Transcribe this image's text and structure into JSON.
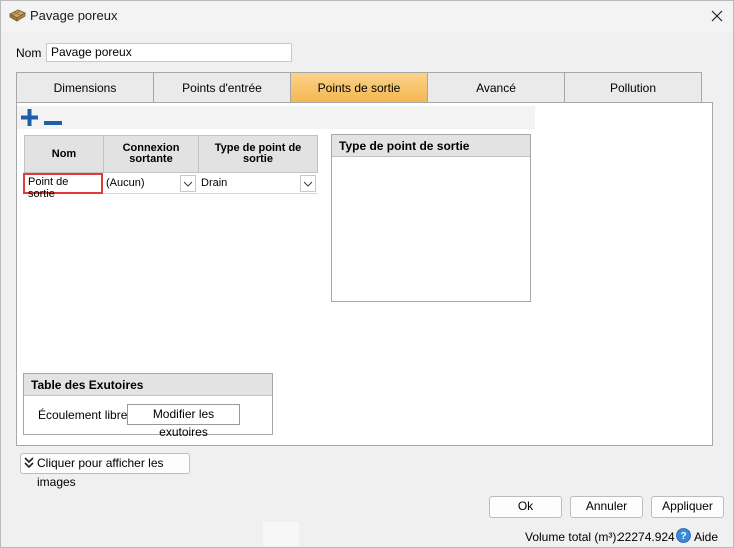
{
  "window": {
    "title": "Pavage poreux"
  },
  "name_field": {
    "label": "Nom",
    "value": "Pavage poreux"
  },
  "tabs": [
    {
      "label": "Dimensions",
      "active": false
    },
    {
      "label": "Points d'entrée",
      "active": false
    },
    {
      "label": "Points de sortie",
      "active": true
    },
    {
      "label": "Avancé",
      "active": false
    },
    {
      "label": "Pollution",
      "active": false
    }
  ],
  "outlet_grid": {
    "headers": [
      "Nom",
      "Connexion sortante",
      "Type de point de sortie"
    ],
    "rows": [
      {
        "name": "Point de sortie",
        "connection": "(Aucun)",
        "type": "Drain"
      }
    ]
  },
  "outlet_type_panel": {
    "title": "Type de point de sortie"
  },
  "outfall_table": {
    "title": "Table des Exutoires",
    "label": "Écoulement libre",
    "button": "Modifier les exutoires"
  },
  "images_toggle": {
    "label": "Cliquer pour afficher les images"
  },
  "footer": {
    "ok": "Ok",
    "cancel": "Annuler",
    "apply": "Appliquer",
    "volume_label": "Volume total (m³):",
    "volume_value": "22274.924",
    "help": "Aide"
  },
  "colors": {
    "active_tab": "#f7c56d",
    "accent_blue": "#1f5fa8",
    "selection_border": "#e03a3a"
  }
}
